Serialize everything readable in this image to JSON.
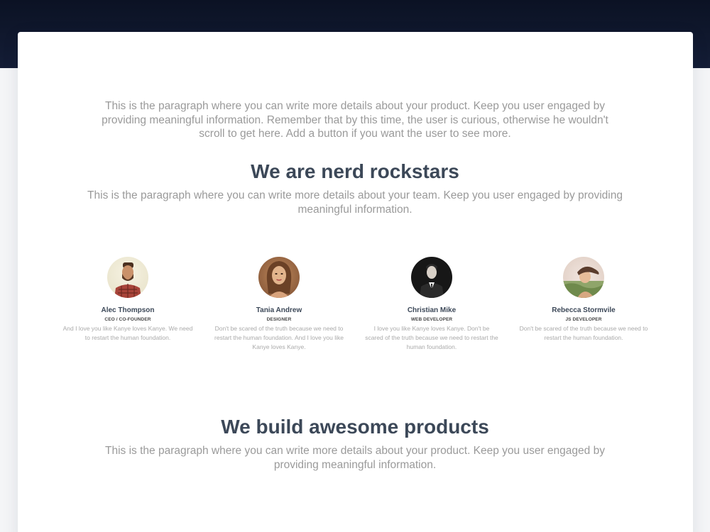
{
  "intro": {
    "paragraph": "This is the paragraph where you can write more details about your product. Keep you user engaged by providing meaningful information. Remember that by this time, the user is curious, otherwise he wouldn't scroll to get here. Add a button if you want the user to see more."
  },
  "team": {
    "title": "We are nerd rockstars",
    "paragraph": "This is the paragraph where you can write more details about your team. Keep you user engaged by providing meaningful information.",
    "members": [
      {
        "name": "Alec Thompson",
        "role": "CEO / CO-FOUNDER",
        "description": "And I love you like Kanye loves Kanye. We need to restart the human foundation."
      },
      {
        "name": "Tania Andrew",
        "role": "DESIGNER",
        "description": "Don't be scared of the truth because we need to restart the human foundation. And I love you like Kanye loves Kanye."
      },
      {
        "name": "Christian Mike",
        "role": "WEB DEVELOPER",
        "description": "I love you like Kanye loves Kanye. Don't be scared of the truth because we need to restart the human foundation."
      },
      {
        "name": "Rebecca Stormvile",
        "role": "JS DEVELOPER",
        "description": "Don't be scared of the truth because we need to restart the human foundation."
      }
    ]
  },
  "products": {
    "title": "We build awesome products",
    "paragraph": "This is the paragraph where you can write more details about your product. Keep you user engaged by providing meaningful information."
  },
  "colors": {
    "header_band": "#0b1224",
    "heading_text": "#3c4858",
    "paragraph_text": "#9a9a9a"
  }
}
